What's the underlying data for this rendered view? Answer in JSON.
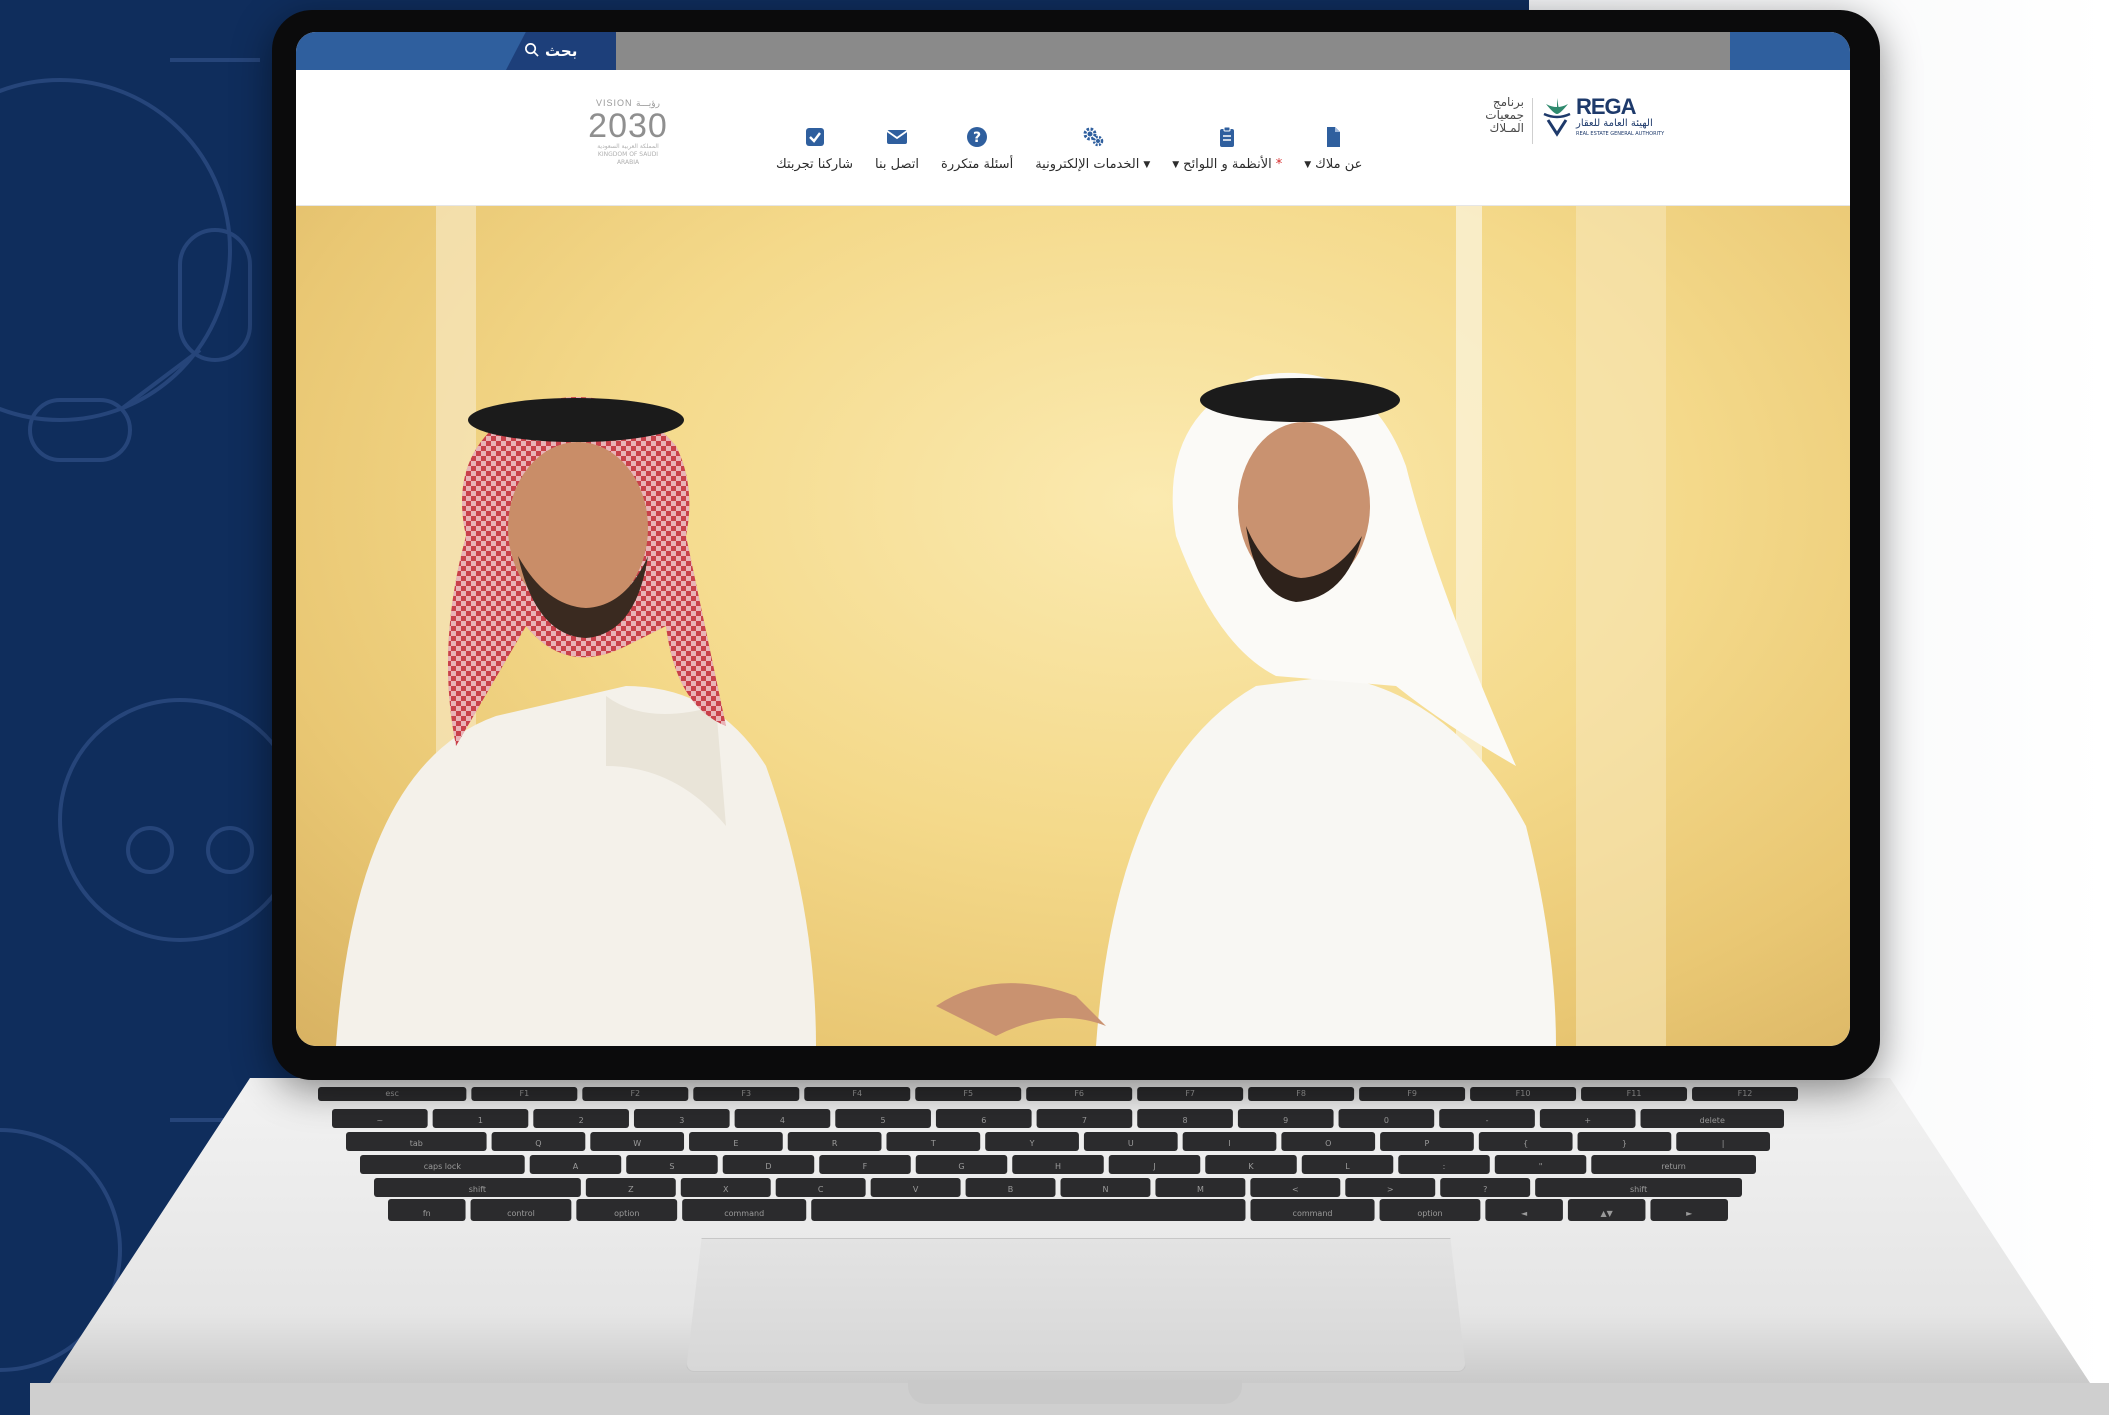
{
  "topbar": {
    "search_label": "بحث",
    "search_icon": "search-icon"
  },
  "header": {
    "vision": {
      "top": "VISION رؤيـــة",
      "year": "2030",
      "sub": "المملكة العربية السعودية\nKINGDOM OF SAUDI ARABIA"
    },
    "nav": [
      {
        "label": "شاركنا تجربتك",
        "icon": "checkbox-icon",
        "caret": false,
        "dot": false
      },
      {
        "label": "اتصل بنا",
        "icon": "envelope-icon",
        "caret": false,
        "dot": false
      },
      {
        "label": "أسئلة متكررة",
        "icon": "question-icon",
        "caret": false,
        "dot": false
      },
      {
        "label": "الخدمات الإلكترونية",
        "icon": "gears-icon",
        "caret": true,
        "dot": false
      },
      {
        "label": "الأنظمة و اللوائح",
        "icon": "clipboard-icon",
        "caret": true,
        "dot": true
      },
      {
        "label": "عن ملاك",
        "icon": "document-icon",
        "caret": true,
        "dot": false
      }
    ],
    "programs_label": "برنامج جمعيات المـلاك",
    "rega": {
      "name": "REGA",
      "arabic": "الهيئة العامة للعقار",
      "english": "REAL ESTATE GENERAL AUTHORITY"
    }
  },
  "keyboard": {
    "row1": [
      "esc",
      "F1",
      "F2",
      "F3",
      "F4",
      "F5",
      "F6",
      "F7",
      "F8",
      "F9",
      "F10",
      "F11",
      "F12"
    ],
    "row2": [
      "~",
      "1",
      "2",
      "3",
      "4",
      "5",
      "6",
      "7",
      "8",
      "9",
      "0",
      "-",
      "+",
      "delete"
    ],
    "row3": [
      "tab",
      "Q",
      "W",
      "E",
      "R",
      "T",
      "Y",
      "U",
      "I",
      "O",
      "P",
      "{",
      "}",
      "|"
    ],
    "row4": [
      "caps lock",
      "A",
      "S",
      "D",
      "F",
      "G",
      "H",
      "J",
      "K",
      "L",
      ":",
      "\"",
      "return"
    ],
    "row5": [
      "shift",
      "Z",
      "X",
      "C",
      "V",
      "B",
      "N",
      "M",
      "<",
      ">",
      "?",
      "shift"
    ],
    "row6": [
      "fn",
      "control",
      "option",
      "command",
      "",
      "command",
      "option",
      "◄",
      "▲▼",
      "►"
    ]
  },
  "colors": {
    "primary": "#2f5f9e",
    "dark_blue": "#0f2d5c",
    "accent_red": "#d62828"
  }
}
